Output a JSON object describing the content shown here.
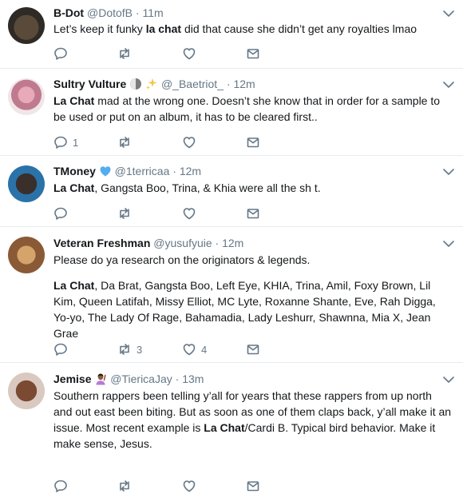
{
  "tweets": [
    {
      "name": "B-Dot",
      "handle": "@DotofB",
      "time": "11m",
      "body": [
        {
          "segments": [
            {
              "text": "Let’s keep it funky ",
              "bold": false
            },
            {
              "text": "la chat",
              "bold": true
            },
            {
              "text": " did that cause she didn’t get any royalties lmao",
              "bold": false
            }
          ]
        }
      ],
      "reply_count": "",
      "retweet_count": "",
      "like_count": ""
    },
    {
      "name": "Sultry Vulture",
      "name_emojis": [
        "half-moon-emoji",
        "sparkles-emoji"
      ],
      "handle": "@_Baetriot_",
      "time": "12m",
      "body": [
        {
          "segments": [
            {
              "text": "La Chat",
              "bold": true
            },
            {
              "text": " mad at the wrong one. Doesn’t she know that in order for a sample to be used or put on an album, it has to be cleared first..",
              "bold": false
            }
          ]
        }
      ],
      "reply_count": "1",
      "retweet_count": "",
      "like_count": ""
    },
    {
      "name": "TMoney",
      "name_emojis": [
        "blue-heart-emoji"
      ],
      "handle": "@1terricaa",
      "time": "12m",
      "body": [
        {
          "segments": [
            {
              "text": "La Chat",
              "bold": true
            },
            {
              "text": ", Gangsta Boo, Trina, & Khia were all the sh t.",
              "bold": false
            }
          ]
        }
      ],
      "reply_count": "",
      "retweet_count": "",
      "like_count": ""
    },
    {
      "name": "Veteran Freshman",
      "handle": "@yusufyuie",
      "time": "12m",
      "body": [
        {
          "segments": [
            {
              "text": "Please do ya research on the originators & legends.",
              "bold": false
            }
          ]
        },
        {
          "segments": [
            {
              "text": "La Chat",
              "bold": true
            },
            {
              "text": ", Da Brat, Gangsta Boo, Left Eye, KHIA, Trina, Amil, Foxy Brown, Lil Kim, Queen Latifah, Missy Elliot, MC Lyte, Roxanne Shante, Eve, Rah Digga, Yo-yo, The Lady Of Rage, Bahamadia, Lady Leshurr, Shawnna, Mia X, Jean Grae",
              "bold": false
            }
          ]
        }
      ],
      "reply_count": "",
      "retweet_count": "3",
      "like_count": "4"
    },
    {
      "name": "Jemise",
      "name_emojis": [
        "woman-raising-hand-emoji"
      ],
      "handle": "@TiericaJay",
      "time": "13m",
      "body": [
        {
          "segments": [
            {
              "text": "Southern rappers been telling y’all for years that these rappers from up north and out east been biting. But as soon as one of them claps back, y’all make it an issue. Most recent example is ",
              "bold": false
            },
            {
              "text": "La Chat",
              "bold": true
            },
            {
              "text": "/Cardi B. Typical bird behavior. Make it make sense, Jesus.",
              "bold": false
            }
          ]
        }
      ],
      "reply_count": "",
      "retweet_count": "",
      "like_count": ""
    }
  ],
  "colors": {
    "text": "#14171a",
    "muted": "#657786",
    "divider": "#e6ecf0",
    "heart_blue": "#55acee",
    "sparkle_gold": "#f4c542"
  }
}
